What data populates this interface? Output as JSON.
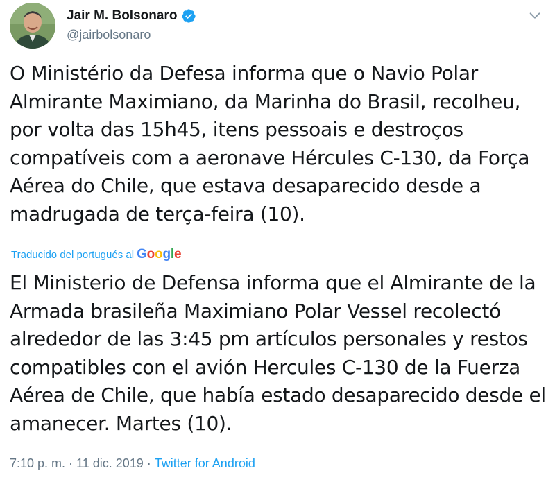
{
  "author": {
    "display_name": "Jair M. Bolsonaro",
    "handle": "@jairbolsonaro",
    "verified": true,
    "verified_color": "#1da1f2"
  },
  "icons": {
    "verified": "verified-badge-icon",
    "menu": "chevron-down-icon"
  },
  "tweet": {
    "text": "O Ministério da Defesa informa que o Navio Polar Almirante Maximiano, da Marinha do Brasil, recolheu, por volta das 15h45, itens pessoais e destroços compatíveis com a aeronave Hércules C-130, da Força Aérea do Chile, que estava desaparecido desde a madrugada de terça-feira (10).",
    "translation_label": "Traducido del portugués al",
    "translation_provider": "Google",
    "translated_text": "El Ministerio de Defensa informa que el Almirante de la Armada brasileña Maximiano Polar Vessel recolectó alrededor de las 3:45 pm artículos personales y restos compatibles con el avión Hercules C-130 de la Fuerza Aérea de Chile, que había estado desaparecido desde el amanecer. Martes (10).",
    "timestamp": "7:10 p. m. · 11 dic. 2019",
    "separator": "·",
    "source": "Twitter for Android"
  },
  "colors": {
    "link": "#1da1f2",
    "text": "#14171a",
    "muted": "#657786"
  }
}
